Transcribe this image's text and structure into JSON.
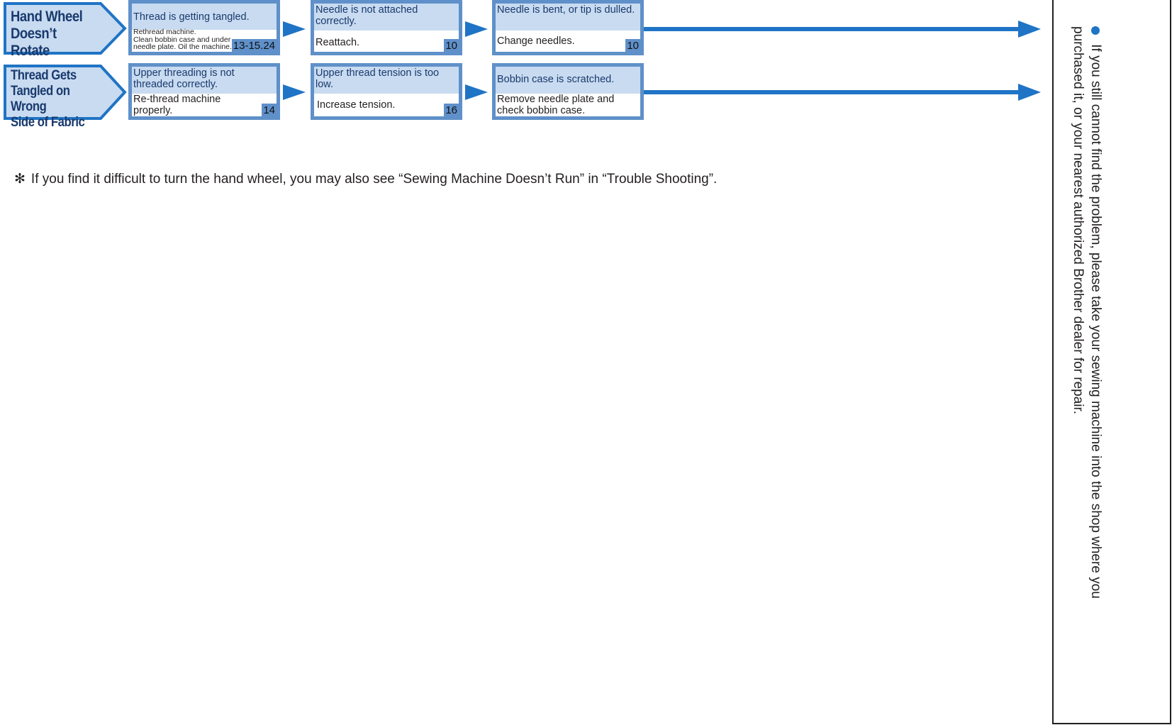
{
  "rows": [
    {
      "heading": "Hand Wheel\nDoesn’t Rotate",
      "steps": [
        {
          "cause": "Thread is getting tangled.",
          "remedy": "Rethread machine.\nClean bobbin case and under needle plate. Oil the machine.",
          "page": "13-15.24"
        },
        {
          "cause": "Needle is not attached correctly.",
          "remedy": "Reattach.",
          "page": "10"
        },
        {
          "cause": "Needle is bent, or tip is dulled.",
          "remedy": "Change needles.",
          "page": "10"
        }
      ]
    },
    {
      "heading": "Thread Gets\nTangled on Wrong\nSide of Fabric",
      "steps": [
        {
          "cause": "Upper threading is not threaded correctly.",
          "remedy": "Re-thread machine properly.",
          "page": "14"
        },
        {
          "cause": "Upper thread tension is too low.",
          "remedy": "Increase tension.",
          "page": "16"
        },
        {
          "cause": "Bobbin case is scratched.",
          "remedy": "Remove needle plate and check bobbin case.",
          "page": ""
        }
      ]
    }
  ],
  "note": {
    "symbol": "✻",
    "text": "If you find it difficult to turn the hand wheel, you may also see “Sewing Machine Doesn’t Run” in “Trouble Shooting”."
  },
  "side_panel": {
    "text": "If you still cannot find the problem, please take your sewing machine into the shop where you purchased it, or your nearest authorized Brother dealer for repair."
  },
  "colors": {
    "box_border": "#5f90c9",
    "cause_fill": "#c8dbf0",
    "arrow": "#1f74c5",
    "heading_text": "#1a3a6e"
  }
}
